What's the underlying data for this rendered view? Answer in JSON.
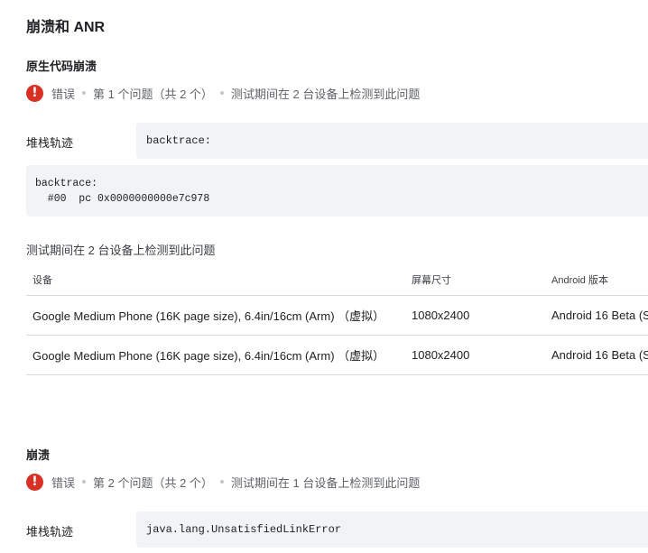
{
  "page": {
    "title": "崩溃和 ANR"
  },
  "issues": [
    {
      "subtitle": "原生代码崩溃",
      "severity": "错误",
      "position": "第 1 个问题（共 2 个）",
      "detected": "测试期间在 2 台设备上检测到此问题",
      "stack_label": "堆栈轨迹",
      "stack_summary": "backtrace:",
      "stack_full": "backtrace:\n  #00  pc 0x0000000000e7c978",
      "devices_caption": "测试期间在 2 台设备上检测到此问题",
      "table": {
        "headers": [
          "设备",
          "屏幕尺寸",
          "Android 版本"
        ],
        "rows": [
          [
            "Google Medium Phone (16K page size), 6.4in/16cm (Arm) （虚拟）",
            "1080x2400",
            "Android 16 Beta (S"
          ],
          [
            "Google Medium Phone (16K page size), 6.4in/16cm (Arm) （虚拟）",
            "1080x2400",
            "Android 16 Beta (S"
          ]
        ]
      }
    },
    {
      "subtitle": "崩溃",
      "severity": "错误",
      "position": "第 2 个问题（共 2 个）",
      "detected": "测试期间在 1 台设备上检测到此问题",
      "stack_label": "堆栈轨迹",
      "stack_summary": "java.lang.UnsatisfiedLinkError"
    }
  ],
  "colors": {
    "error": "#d93025",
    "code_bg": "#f1f3f4",
    "divider": "#dadce0"
  },
  "icons": {
    "severity": "error-circle-icon"
  }
}
